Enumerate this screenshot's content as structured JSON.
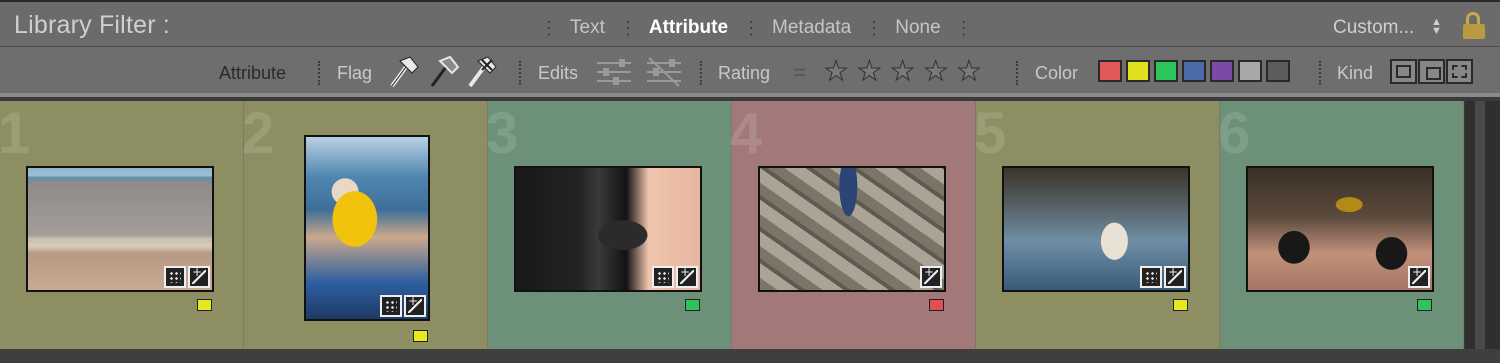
{
  "filter_bar": {
    "title": "Library Filter :",
    "modes": [
      "Text",
      "Attribute",
      "Metadata",
      "None"
    ],
    "active_mode": "Attribute",
    "preset": "Custom...",
    "preset_arrows": "⇕"
  },
  "attribute_bar": {
    "label": "Attribute",
    "flag_label": "Flag",
    "edits_label": "Edits",
    "rating_label": "Rating",
    "rating_operator": "=",
    "rating_stars": 5,
    "color_label": "Color",
    "color_swatches": [
      "#e05858",
      "#e0e020",
      "#2ec45c",
      "#4a6aa8",
      "#7b4aa8",
      "#a8a8a8",
      "#5c5c5c"
    ],
    "kind_label": "Kind"
  },
  "grid": {
    "cells": [
      {
        "index": "1",
        "bg": "#8d8f62",
        "label_color": "yellow",
        "label_hex": "#e8e820",
        "badges": [
          "dots",
          "adj"
        ],
        "orientation": "landscape",
        "photo": "beach"
      },
      {
        "index": "2",
        "bg": "#8d8f62",
        "label_color": "yellow",
        "label_hex": "#e8e820",
        "badges": [
          "dots",
          "adj"
        ],
        "orientation": "portrait",
        "photo": "woman-dog"
      },
      {
        "index": "3",
        "bg": "#6c9078",
        "label_color": "green",
        "label_hex": "#2ec45c",
        "badges": [
          "dots",
          "adj"
        ],
        "orientation": "landscape",
        "photo": "camera"
      },
      {
        "index": "4",
        "bg": "#a37878",
        "label_color": "red",
        "label_hex": "#e05050",
        "badges": [
          "adj"
        ],
        "orientation": "landscape",
        "photo": "wall"
      },
      {
        "index": "5",
        "bg": "#8d8f62",
        "label_color": "yellow",
        "label_hex": "#e8e820",
        "badges": [
          "dots",
          "adj"
        ],
        "orientation": "landscape",
        "photo": "cafe"
      },
      {
        "index": "6",
        "bg": "#6c9078",
        "label_color": "green",
        "label_hex": "#2ec45c",
        "badges": [
          "adj"
        ],
        "orientation": "landscape",
        "photo": "motorcycle"
      }
    ]
  }
}
